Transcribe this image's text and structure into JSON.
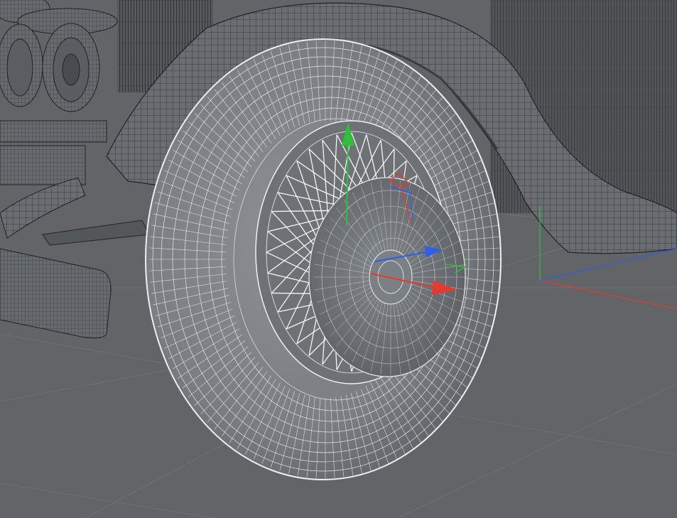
{
  "viewport": {
    "kind": "3d-modeling-viewport",
    "shading": "gouraud-shading-with-wireframe",
    "selected_object": "wheel",
    "gizmo": "move-tool",
    "axis_colors": {
      "x": "#e53b2f",
      "y": "#2fbf3a",
      "z": "#2f5fe5"
    },
    "wire_color_selected": "#f2f2f2",
    "wire_color_default": "#222629",
    "floor_color": "#626467",
    "grid_color": "#6c6e71",
    "mesh_color": "#6b6f73"
  }
}
